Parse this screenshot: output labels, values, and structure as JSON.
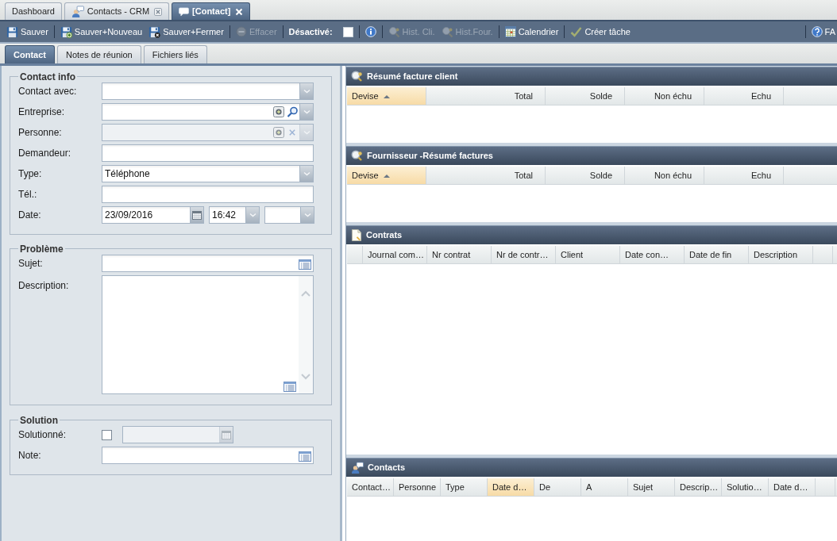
{
  "tabs": [
    {
      "label": "Dashboard",
      "kind": "plain",
      "selected": false,
      "closable": false
    },
    {
      "label": "Contacts - CRM",
      "kind": "people",
      "selected": false,
      "closable": true
    },
    {
      "label": "[Contact]",
      "kind": "chat",
      "selected": true,
      "closable": true
    }
  ],
  "toolbar": {
    "groups": [
      [
        {
          "kind": "save",
          "label": "Sauver",
          "disabled": false
        }
      ],
      [
        {
          "kind": "savenew",
          "label": "Sauver+Nouveau",
          "disabled": false
        },
        {
          "kind": "saveclose",
          "label": "Sauver+Fermer",
          "disabled": false
        }
      ],
      [
        {
          "kind": "erase",
          "label": "Effacer",
          "disabled": true
        }
      ],
      [
        {
          "kind": "toggle",
          "label": "Désactivé:",
          "checked": false
        }
      ],
      [
        {
          "kind": "info",
          "disabled": false
        }
      ],
      [
        {
          "kind": "history",
          "label": "Hist. Cli.",
          "disabled": true
        },
        {
          "kind": "history",
          "label": "Hist.Four.",
          "disabled": true
        }
      ],
      [
        {
          "kind": "calendar",
          "label": "Calendrier",
          "disabled": false
        }
      ],
      [
        {
          "kind": "task",
          "label": "Créer tâche",
          "disabled": false
        }
      ]
    ],
    "end_group": [
      {
        "kind": "help",
        "label": "FA",
        "disabled": false
      }
    ]
  },
  "subtabs": [
    {
      "label": "Contact",
      "selected": true
    },
    {
      "label": "Notes de réunion",
      "selected": false
    },
    {
      "label": "Fichiers liés",
      "selected": false
    }
  ],
  "form": {
    "sections": [
      {
        "legend": "Contact info",
        "fields": [
          {
            "label": "Contact avec:",
            "kind": "combo",
            "disabled": false
          },
          {
            "label": "Entreprise:",
            "kind": "search",
            "disabled": false
          },
          {
            "label": "Personne:",
            "kind": "clearable",
            "disabled": true
          },
          {
            "label": "Demandeur:",
            "kind": "text",
            "disabled": false
          },
          {
            "label": "Type:",
            "kind": "combo",
            "value": "Téléphone",
            "disabled": false
          },
          {
            "label": "Tél.:",
            "kind": "text",
            "disabled": false
          },
          {
            "label": "Date:",
            "kind": "datetime",
            "date": "23/09/2016",
            "time": "16:42",
            "disabled": false
          }
        ]
      },
      {
        "legend": "Problème",
        "fields": [
          {
            "label": "Sujet:",
            "kind": "memo",
            "disabled": false
          },
          {
            "label": "Description:",
            "kind": "textarea",
            "disabled": false
          }
        ]
      },
      {
        "legend": "Solution",
        "fields": [
          {
            "label": "Solutionné:",
            "kind": "checkdate",
            "checked": false,
            "disabled": true
          },
          {
            "label": "Note:",
            "kind": "memo",
            "disabled": false
          }
        ]
      }
    ]
  },
  "panels": [
    {
      "title": "Résumé facture client",
      "kind": "summary",
      "columns": [
        {
          "label": "Devise",
          "kind": "text",
          "highlighted": true,
          "sorted": true
        },
        {
          "label": "Total",
          "kind": "number",
          "highlighted": false,
          "sorted": false
        },
        {
          "label": "Solde",
          "kind": "number",
          "highlighted": false,
          "sorted": false
        },
        {
          "label": "Non échu",
          "kind": "number",
          "highlighted": false,
          "sorted": false
        },
        {
          "label": "Echu",
          "kind": "number",
          "highlighted": false,
          "sorted": false
        }
      ]
    },
    {
      "title": "Fournisseur -Résumé factures",
      "kind": "summary",
      "columns": [
        {
          "label": "Devise",
          "kind": "text",
          "highlighted": true,
          "sorted": true
        },
        {
          "label": "Total",
          "kind": "number",
          "highlighted": false,
          "sorted": false
        },
        {
          "label": "Solde",
          "kind": "number",
          "highlighted": false,
          "sorted": false
        },
        {
          "label": "Non échu",
          "kind": "number",
          "highlighted": false,
          "sorted": false
        },
        {
          "label": "Echu",
          "kind": "number",
          "highlighted": false,
          "sorted": false
        }
      ]
    },
    {
      "title": "Contrats",
      "kind": "contracts",
      "columns": [
        {
          "label": "Journal com…",
          "kind": "text",
          "highlighted": false,
          "sorted": false
        },
        {
          "label": "Nr contrat",
          "kind": "text",
          "highlighted": false,
          "sorted": false
        },
        {
          "label": "Nr de contr…",
          "kind": "text",
          "highlighted": false,
          "sorted": false
        },
        {
          "label": "Client",
          "kind": "text",
          "highlighted": false,
          "sorted": false
        },
        {
          "label": "Date con…",
          "kind": "text",
          "highlighted": false,
          "sorted": false
        },
        {
          "label": "Date de fin",
          "kind": "text",
          "highlighted": false,
          "sorted": false
        },
        {
          "label": "Description",
          "kind": "text",
          "highlighted": false,
          "sorted": false
        }
      ]
    },
    {
      "title": "Contacts",
      "kind": "people",
      "columns": [
        {
          "label": "Contact…",
          "kind": "text",
          "highlighted": false,
          "sorted": false
        },
        {
          "label": "Personne",
          "kind": "text",
          "highlighted": false,
          "sorted": false
        },
        {
          "label": "Type",
          "kind": "text",
          "highlighted": false,
          "sorted": false
        },
        {
          "label": "Date d…",
          "kind": "text",
          "highlighted": true,
          "sorted": false
        },
        {
          "label": "De",
          "kind": "text",
          "highlighted": false,
          "sorted": false
        },
        {
          "label": "A",
          "kind": "text",
          "highlighted": false,
          "sorted": false
        },
        {
          "label": "Sujet",
          "kind": "text",
          "highlighted": false,
          "sorted": false
        },
        {
          "label": "Descrip…",
          "kind": "text",
          "highlighted": false,
          "sorted": false
        },
        {
          "label": "Solutio…",
          "kind": "text",
          "highlighted": false,
          "sorted": false
        },
        {
          "label": "Date d…",
          "kind": "text",
          "highlighted": false,
          "sorted": false
        }
      ]
    }
  ]
}
